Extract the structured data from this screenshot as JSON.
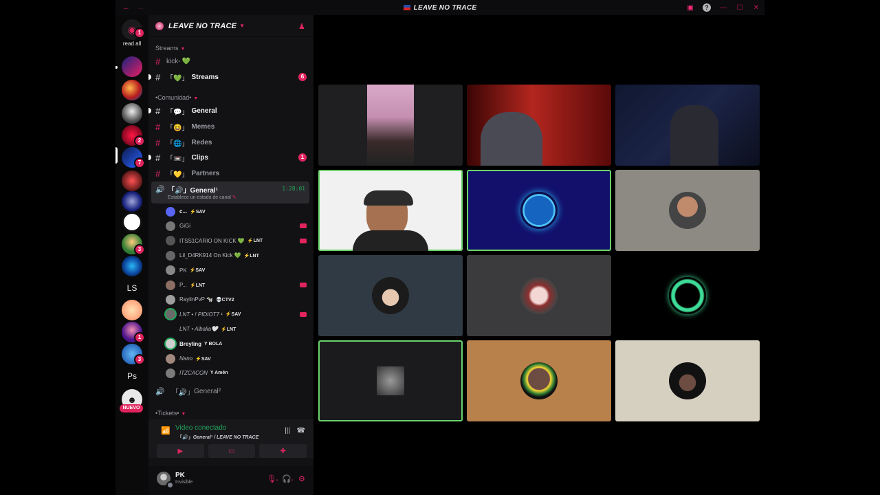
{
  "window": {
    "title": "LEAVE NO TRACE",
    "back_icon": "arrow-left-icon",
    "forward_icon": "arrow-right-icon"
  },
  "rail": {
    "read_all": "read all",
    "dm_badge": "1",
    "text_servers": [
      "LS",
      "Ps"
    ],
    "new_label": "NUEVO",
    "badges": [
      "2",
      "7",
      "3",
      "1",
      "3"
    ]
  },
  "server": {
    "name": "LEAVE NO TRACE"
  },
  "categories": {
    "streams": "Streams",
    "comunidad": "•Comunidad•",
    "tickets": "•Tickets•"
  },
  "channels": [
    {
      "name": "kick-",
      "emoji": "💚",
      "style": "plain"
    },
    {
      "name": "Streams",
      "bracket": "「💚」",
      "badge": "6",
      "style": "bright"
    },
    {
      "name": "General",
      "bracket": "「💬」",
      "style": "bright"
    },
    {
      "name": "Memes",
      "bracket": "「😆」",
      "style": "dim"
    },
    {
      "name": "Redes",
      "bracket": "「🌐」",
      "style": "dim"
    },
    {
      "name": "Clips",
      "bracket": "「📼」",
      "badge": "1",
      "style": "bright"
    },
    {
      "name": "Partners",
      "bracket": "「💛」",
      "style": "dim"
    }
  ],
  "voice_channel": {
    "name": "General¹",
    "bracket": "「🔊」",
    "timer": "1:28:01",
    "status": "Establece un estado de canal"
  },
  "voice_users": [
    {
      "name": "c...",
      "tag": "⚡SAV",
      "style": "b"
    },
    {
      "name": "GiGi",
      "tag": "",
      "style": "",
      "live": true
    },
    {
      "name": "ITSS1CARIO ON KICK 💚",
      "tag": "⚡LNT",
      "style": "",
      "live": true
    },
    {
      "name": "Lil_D4RK914 On Kick 💚",
      "tag": "⚡LNT",
      "style": ""
    },
    {
      "name": "PK",
      "tag": "⚡SAV",
      "style": ""
    },
    {
      "name": "P...",
      "tag": "⚡LNT",
      "style": "",
      "live": true
    },
    {
      "name": "RaylinPvP 🐄",
      "tag": "💀CTV2",
      "style": ""
    },
    {
      "name": "LNT • ! PIDIOT7 ¹",
      "tag": "⚡SAV",
      "style": "i",
      "live": true
    },
    {
      "name": "LNT • Albalia🤍",
      "tag": "⚡LNT",
      "style": "i"
    },
    {
      "name": "Breyling",
      "tag": "Y BOLA",
      "style": "b"
    },
    {
      "name": "Nano",
      "tag": "⚡SAV",
      "style": "i"
    },
    {
      "name": "ITZCACON",
      "tag": "Y Amén",
      "style": "i"
    }
  ],
  "voice_channel_2": {
    "name": "General²",
    "bracket": "「🔊」"
  },
  "voice_connection": {
    "status": "Video conectado",
    "location": "General¹ / LEAVE NO TRACE",
    "location_prefix": "「🔊」"
  },
  "user": {
    "name": "PK",
    "status": "Invisible"
  },
  "colors": {
    "accent": "#e0245e",
    "speaking": "#23a55a"
  }
}
